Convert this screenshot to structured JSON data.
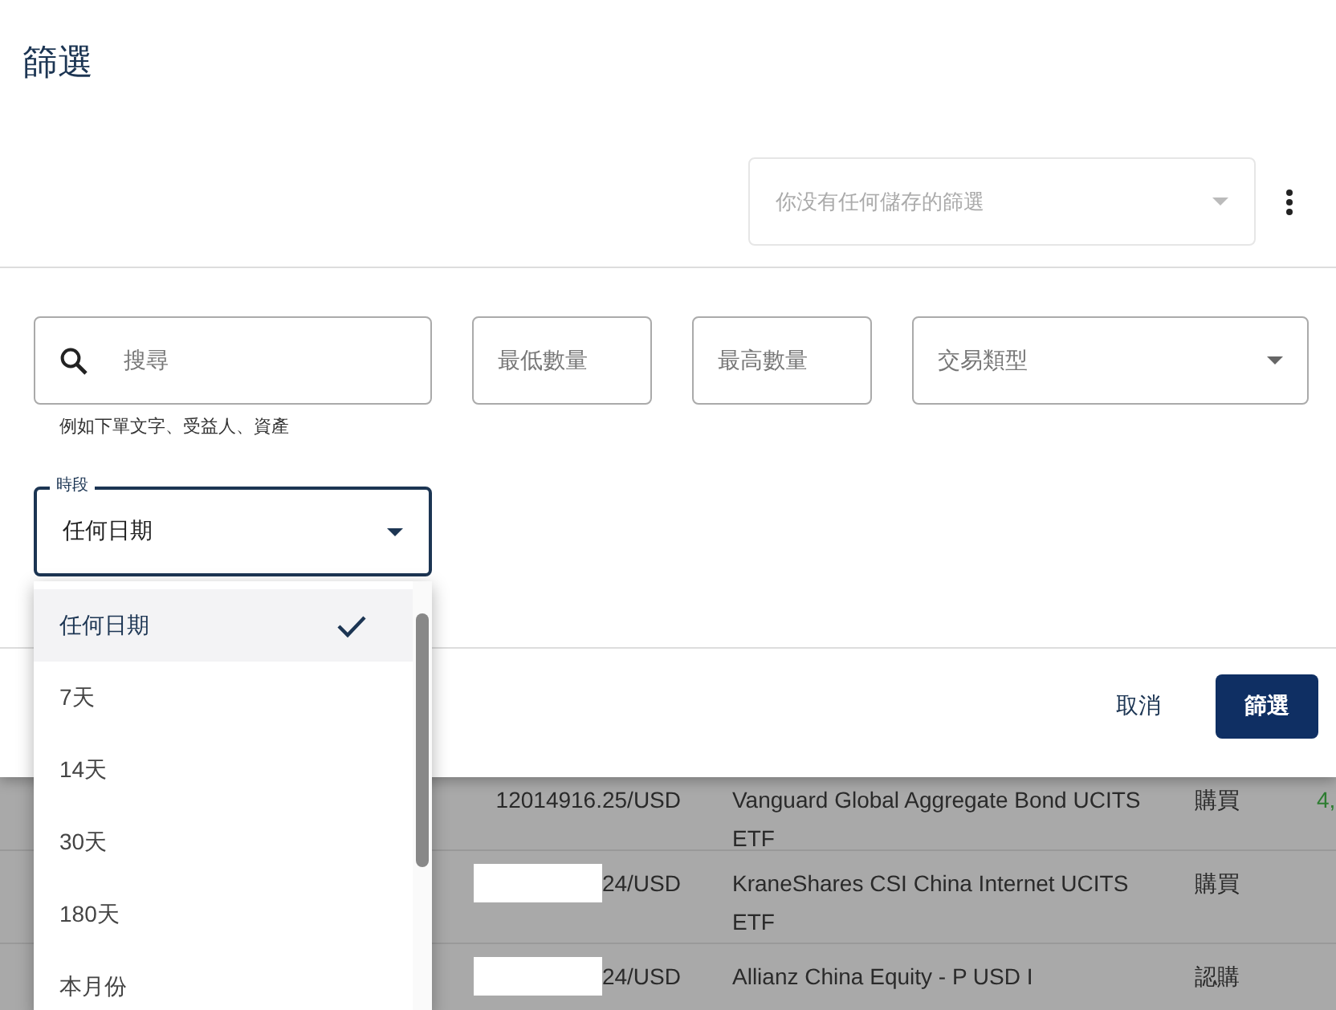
{
  "dialog": {
    "title": "篩選",
    "saved_filters": {
      "placeholder": "你没有任何儲存的篩選"
    }
  },
  "filters": {
    "search": {
      "placeholder": "搜尋",
      "helper": "例如下單文字、受益人、資產"
    },
    "min_amount": {
      "placeholder": "最低數量"
    },
    "max_amount": {
      "placeholder": "最高數量"
    },
    "transaction_type": {
      "placeholder": "交易類型"
    },
    "period": {
      "label": "時段",
      "value": "任何日期",
      "expanded": true
    }
  },
  "period_options": [
    {
      "label": "任何日期",
      "selected": true
    },
    {
      "label": "7天",
      "selected": false
    },
    {
      "label": "14天",
      "selected": false
    },
    {
      "label": "30天",
      "selected": false
    },
    {
      "label": "180天",
      "selected": false
    },
    {
      "label": "本月份",
      "selected": false
    }
  ],
  "buttons": {
    "cancel": "取消",
    "apply": "篩選"
  },
  "table": {
    "rows": [
      {
        "amount": "12014916.25/USD",
        "redacted": false,
        "asset": "Vanguard Global Aggregate Bond UCITS ETF",
        "type": "購買",
        "column_4": "4,"
      },
      {
        "amount": "24/USD",
        "redacted": true,
        "asset": "KraneShares CSI China Internet UCITS ETF",
        "type": "購買"
      },
      {
        "amount": "24/USD",
        "redacted": true,
        "asset": "Allianz China Equity - P USD I",
        "type": "認購"
      }
    ]
  }
}
